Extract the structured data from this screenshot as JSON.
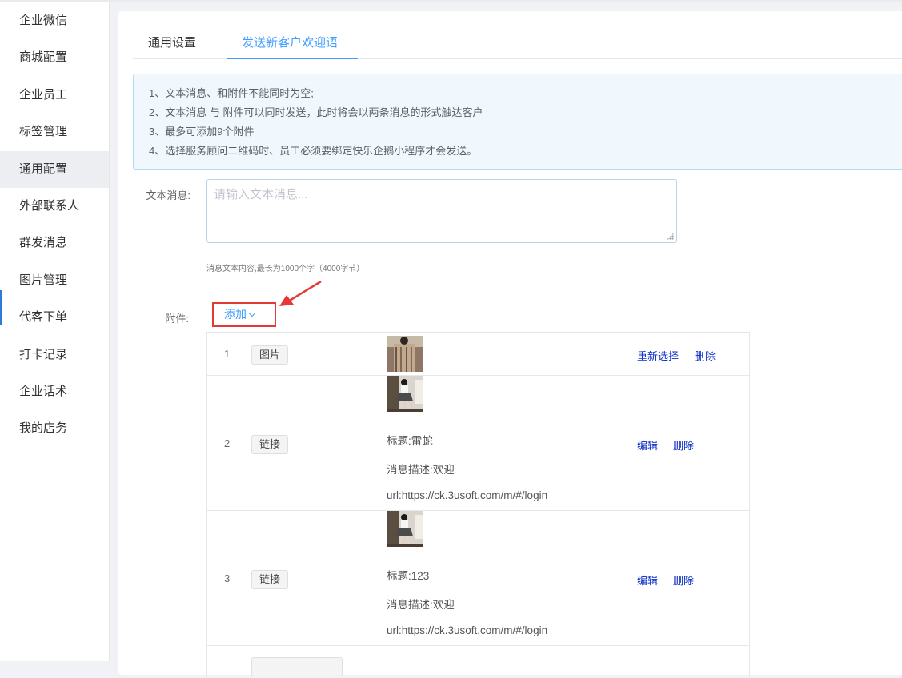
{
  "sidebar": {
    "items": [
      "企业微信",
      "商城配置",
      "企业员工",
      "标签管理",
      "通用配置",
      "外部联系人",
      "群发消息",
      "图片管理",
      "代客下单",
      "打卡记录",
      "企业话术",
      "我的店务"
    ],
    "active_index": 4
  },
  "tabs": [
    "通用设置",
    "发送新客户欢迎语"
  ],
  "active_tab": 1,
  "notice": [
    "1、文本消息、和附件不能同时为空;",
    "2、文本消息 与 附件可以同时发送，此时将会以两条消息的形式触达客户",
    "3、最多可添加9个附件",
    "4、选择服务顾问二维码时、员工必须要绑定快乐企鹅小程序才会发送。"
  ],
  "form": {
    "text_label": "文本消息:",
    "text_placeholder": "请输入文本消息...",
    "text_value": "",
    "hint": "消息文本内容,最长为1000个字（4000字节）",
    "attach_label": "附件:",
    "add_label": "添加"
  },
  "attachments": [
    {
      "index": "1",
      "type": "图片",
      "actions": [
        "重新选择",
        "删除"
      ]
    },
    {
      "index": "2",
      "type": "链接",
      "title": "标题:雷蛇",
      "desc": "消息描述:欢迎",
      "url": "url:https://ck.3usoft.com/m/#/login",
      "actions": [
        "编辑",
        "删除"
      ]
    },
    {
      "index": "3",
      "type": "链接",
      "title": "标题:123",
      "desc": "消息描述:欢迎",
      "url": "url:https://ck.3usoft.com/m/#/login",
      "actions": [
        "编辑",
        "删除"
      ]
    }
  ],
  "colors": {
    "accent": "#409eff",
    "highlight_box": "#e53935",
    "action_link": "#0b2cc7"
  }
}
